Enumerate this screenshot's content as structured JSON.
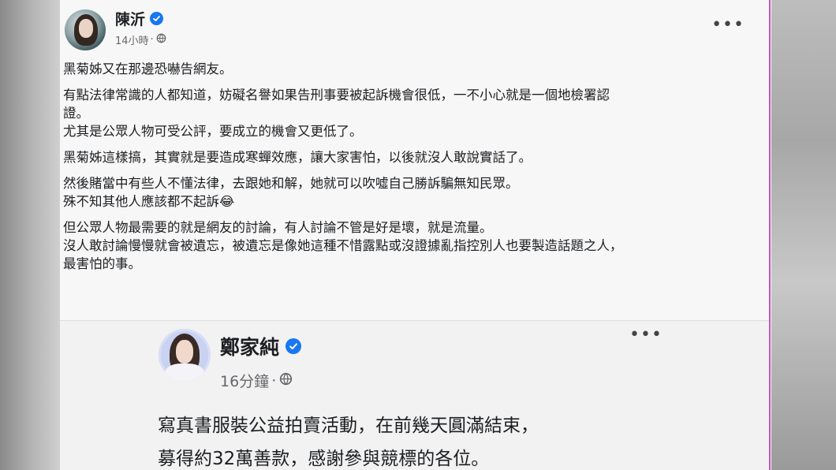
{
  "post": {
    "author": "陳沂",
    "time": "14小時",
    "separator": "·",
    "more": "•••",
    "paragraphs": [
      [
        "黑菊姊又在那邊恐嚇告網友。"
      ],
      [
        "有點法律常識的人都知道，妨礙名譽如果告刑事要被起訴機會很低，一不小心就是一個地檢署認",
        "證。",
        "尤其是公眾人物可受公評，要成立的機會又更低了。"
      ],
      [
        "黑菊姊這樣搞，其實就是要造成寒蟬效應，讓大家害怕，以後就沒人敢說實話了。"
      ],
      [
        "然後賭當中有些人不懂法律，去跟她和解，她就可以吹噓自己勝訴騙無知民眾。",
        "殊不知其他人應該都不起訴😂"
      ],
      [
        "但公眾人物最需要的就是網友的討論，有人討論不管是好是壞，就是流量。",
        "沒人敢討論慢慢就會被遺忘，被遺忘是像她這種不惜露點或沒證據亂指控別人也要製造話題之人，",
        "最害怕的事。"
      ]
    ]
  },
  "shared_post": {
    "author": "鄭家純",
    "time": "16分鐘",
    "separator": "·",
    "more": "•••",
    "lines": [
      "寫真書服裝公益拍賣活動，在前幾天圓滿結束，",
      "募得約32萬善款，感謝參與競標的各位。"
    ]
  },
  "colors": {
    "verified": "#1877f2",
    "text": "#1c1e21",
    "meta": "#65676b",
    "edge_accent": "#c255b8"
  },
  "icons": [
    "verified-badge-icon",
    "globe-icon",
    "more-options-icon"
  ]
}
